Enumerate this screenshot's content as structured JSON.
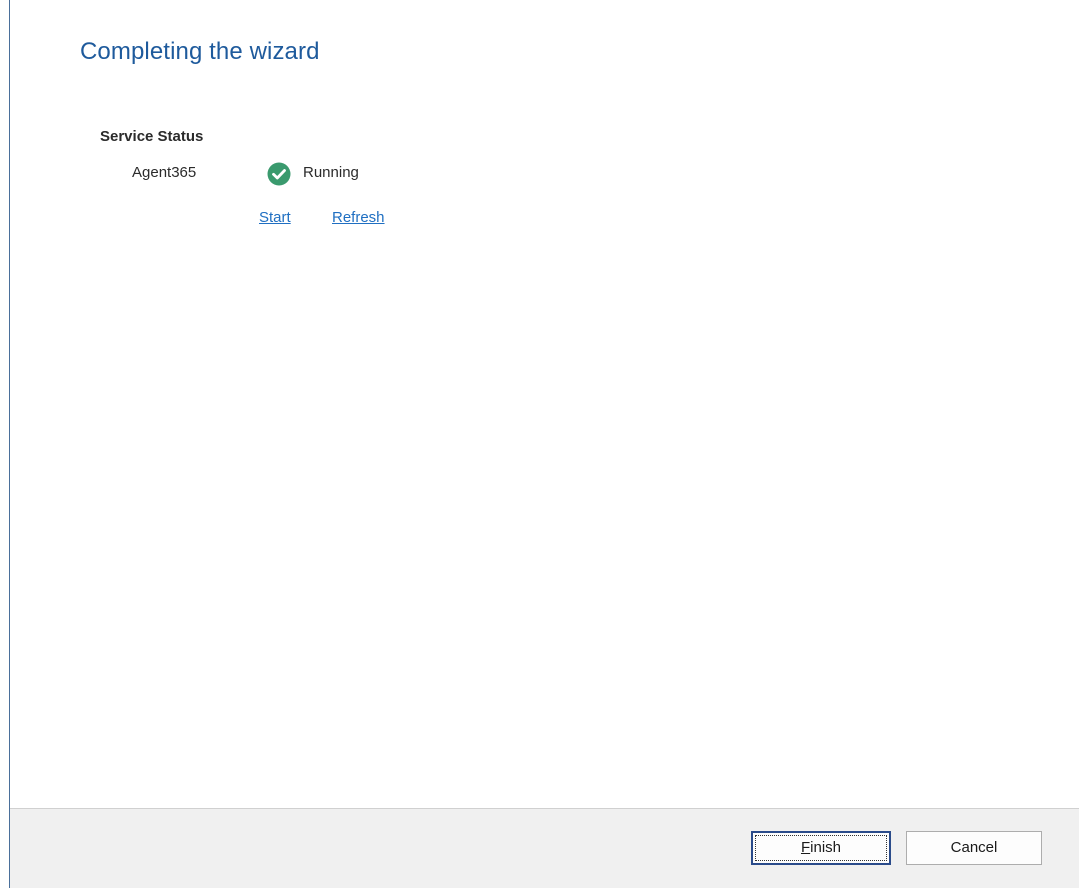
{
  "wizard": {
    "title": "Completing the wizard"
  },
  "service_status": {
    "heading": "Service Status",
    "service_name": "Agent365",
    "status_text": "Running",
    "status_icon": "check-circle-icon",
    "status_color": "#3a9a6e"
  },
  "links": {
    "start_label": "Start",
    "refresh_label": "Refresh"
  },
  "footer": {
    "finish_mnemonic": "F",
    "finish_rest": "inish",
    "cancel_label": "Cancel"
  },
  "colors": {
    "title": "#1e5a9c",
    "link": "#1f6fc2",
    "footer_bg": "#f0f0f0",
    "default_button_border": "#2a4b8a"
  }
}
